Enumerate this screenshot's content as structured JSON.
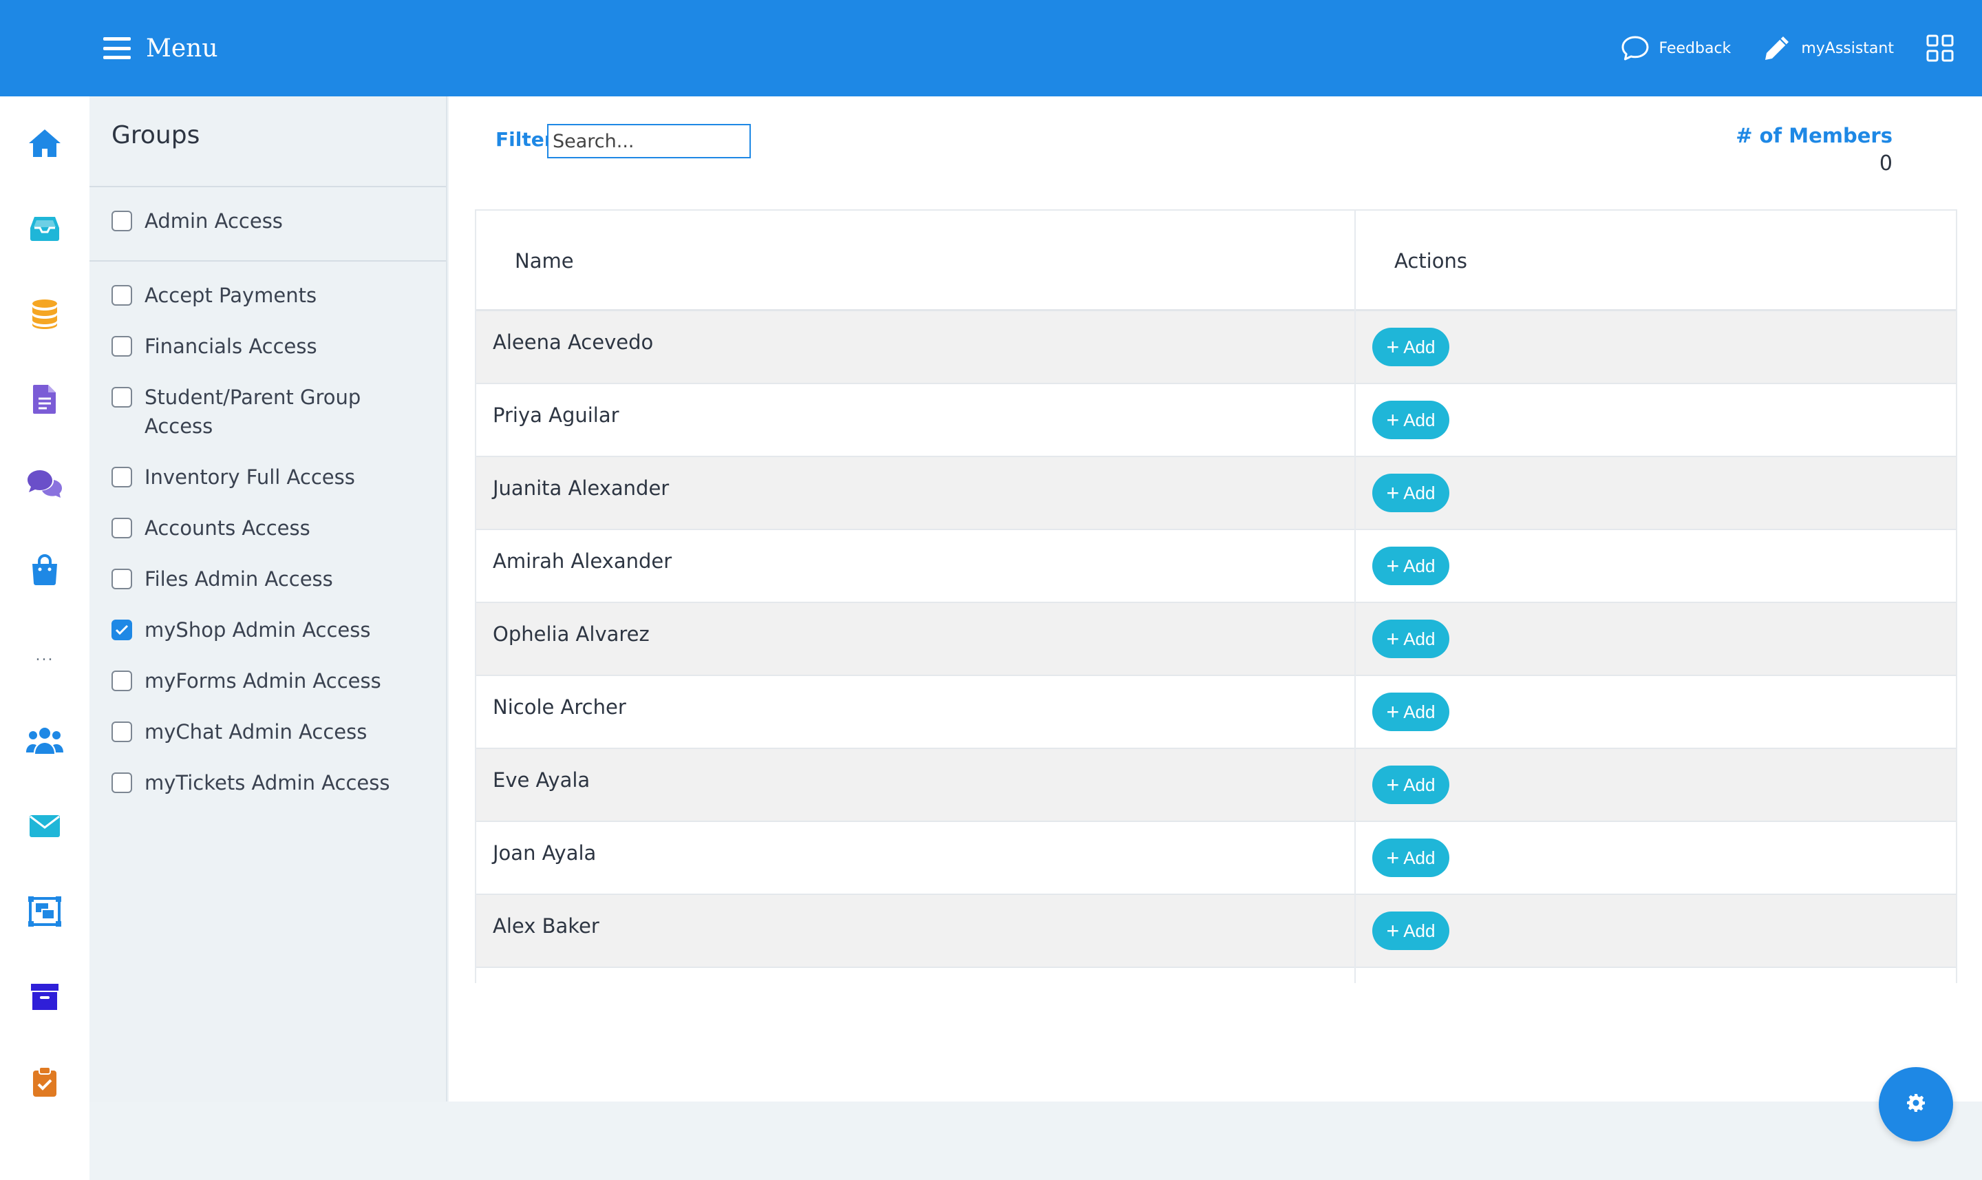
{
  "topbar": {
    "menu_label": "Menu",
    "feedback_label": "Feedback",
    "assistant_label": "myAssistant",
    "bg_color": "#1e88e5"
  },
  "rail": {
    "icons": [
      "home-icon",
      "inbox-icon",
      "database-icon",
      "document-icon",
      "chat-bubbles-icon",
      "shopping-bag-icon",
      "more-dots-icon",
      "users-icon",
      "mail-icon",
      "gallery-icon",
      "archive-icon",
      "clipboard-check-icon"
    ],
    "more_label": "..."
  },
  "groups": {
    "title": "Groups",
    "items": [
      {
        "label": "Admin Access",
        "checked": false
      },
      {
        "label": "Accept Payments",
        "checked": false
      },
      {
        "label": "Financials Access",
        "checked": false
      },
      {
        "label": "Student/Parent Group",
        "label2": "Access",
        "checked": false
      },
      {
        "label": "Inventory Full Access",
        "checked": false
      },
      {
        "label": "Accounts Access",
        "checked": false
      },
      {
        "label": "Files Admin Access",
        "checked": false
      },
      {
        "label": "myShop Admin Access",
        "checked": true
      },
      {
        "label": "myForms Admin Access",
        "checked": false
      },
      {
        "label": "myChat Admin Access",
        "checked": false
      },
      {
        "label": "myTickets Admin Access",
        "checked": false
      }
    ]
  },
  "main": {
    "filter_label": "Filter",
    "search_placeholder": "Search...",
    "members_label": "# of Members",
    "members_count": "0",
    "table": {
      "col_name": "Name",
      "col_actions": "Actions",
      "add_label": "Add",
      "rows": [
        "Aleena Acevedo",
        "Priya Aguilar",
        "Juanita Alexander",
        "Amirah Alexander",
        "Ophelia Alvarez",
        "Nicole Archer",
        "Eve Ayala",
        "Joan Ayala",
        "Alex Baker"
      ]
    }
  },
  "colors": {
    "accent": "#1e88e5",
    "add_button": "#1fb6d8"
  }
}
